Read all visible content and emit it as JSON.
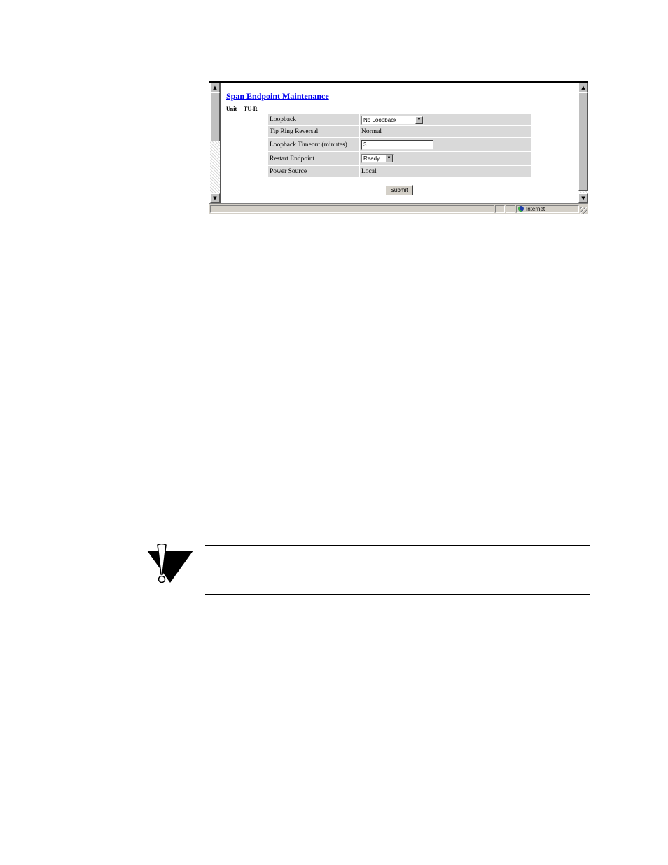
{
  "page": {
    "title": "Span Endpoint Maintenance",
    "unit_label": "Unit",
    "unit_value": "TU-R"
  },
  "table": {
    "rows": [
      {
        "label": "Loopback",
        "control": "select",
        "value": "No Loopback"
      },
      {
        "label": "Tip Ring Reversal",
        "control": "text",
        "value": "Normal"
      },
      {
        "label": "Loopback Timeout (minutes)",
        "control": "input",
        "value": "3"
      },
      {
        "label": "Restart Endpoint",
        "control": "select",
        "value": "Ready"
      },
      {
        "label": "Power Source",
        "control": "text",
        "value": "Local"
      }
    ]
  },
  "submit_label": "Submit",
  "statusbar": {
    "zone": "Internet",
    "zone_icon": "globe-icon"
  },
  "scrollbars": {
    "up_arrow": "▲",
    "down_arrow": "▼"
  },
  "colors": {
    "link": "#0000ee",
    "table_bg": "#d9d9d9"
  }
}
